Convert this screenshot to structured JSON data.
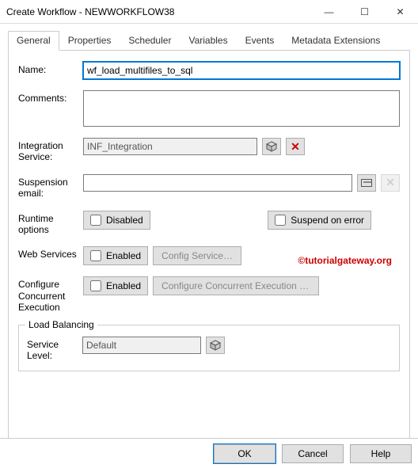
{
  "window": {
    "title": "Create Workflow - NEWWORKFLOW38",
    "min": "—",
    "max": "☐",
    "close": "✕"
  },
  "tabs": {
    "general": "General",
    "properties": "Properties",
    "scheduler": "Scheduler",
    "variables": "Variables",
    "events": "Events",
    "metadata": "Metadata Extensions"
  },
  "labels": {
    "name": "Name:",
    "comments": "Comments:",
    "integration": "Integration Service:",
    "suspension": "Suspension email:",
    "runtime": "Runtime options",
    "web": "Web Services",
    "concurrent": "Configure Concurrent Execution",
    "loadbal": "Load Balancing",
    "service_level": "Service Level:"
  },
  "values": {
    "name": "wf_load_multifiles_to_sql",
    "comments": "",
    "integration": "INF_Integration",
    "suspension": "",
    "service_level": "Default"
  },
  "checkboxes": {
    "disabled": "Disabled",
    "suspend": "Suspend on error",
    "web_enabled": "Enabled",
    "cce_enabled": "Enabled"
  },
  "buttons": {
    "config_service": "Config Service…",
    "config_cce": "Configure Concurrent Execution …",
    "ok": "OK",
    "cancel": "Cancel",
    "help": "Help"
  },
  "icons": {
    "browse": "browse-cube-icon",
    "delete": "delete-x-icon",
    "email": "address-card-icon",
    "email_clear": "clear-x-icon",
    "level_browse": "browse-cube-icon"
  },
  "watermark": "tutorialgateway.org"
}
